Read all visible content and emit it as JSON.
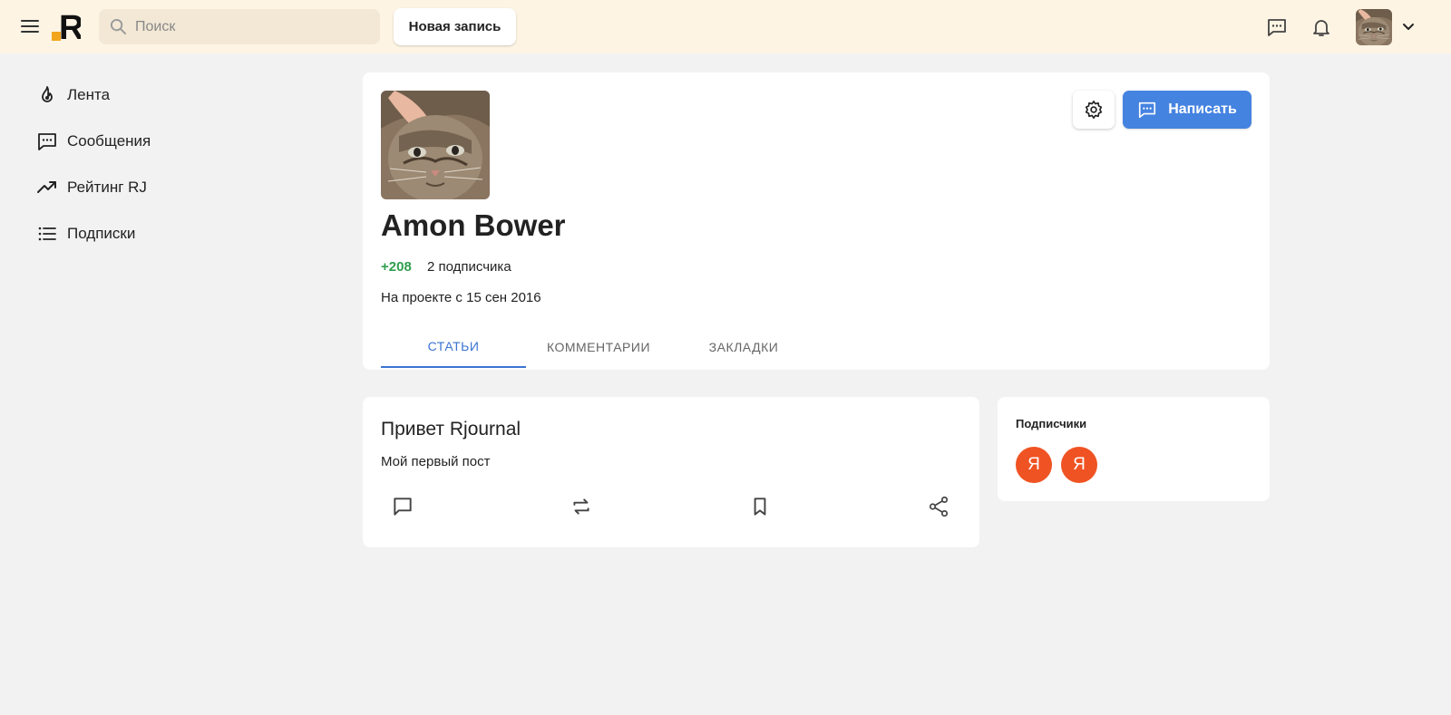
{
  "header": {
    "search_placeholder": "Поиск",
    "new_post_label": "Новая запись",
    "logo_text": "R",
    "bg_color": "#fef4e3",
    "icons": [
      "menu-icon",
      "search-icon",
      "message-icon",
      "bell-icon",
      "chevron-down-icon"
    ]
  },
  "sidebar": {
    "items": [
      {
        "label": "Лента",
        "icon": "fire-icon"
      },
      {
        "label": "Сообщения",
        "icon": "message-icon"
      },
      {
        "label": "Рейтинг RJ",
        "icon": "trending-up-icon"
      },
      {
        "label": "Подписки",
        "icon": "list-icon"
      }
    ]
  },
  "profile": {
    "name": "Amon Bower",
    "rating": "+208",
    "subscribers_text": "2 подписчика",
    "since_text": "На проекте с 15 сен 2016",
    "write_button_label": "Написать",
    "accent_color": "#4583e0",
    "rating_color": "#2f9e4f",
    "tabs": [
      {
        "label": "СТАТЬИ",
        "active": true
      },
      {
        "label": "КОММЕНТАРИИ",
        "active": false
      },
      {
        "label": "ЗАКЛАДКИ",
        "active": false
      }
    ]
  },
  "post": {
    "title": "Привет Rjournal",
    "text": "Мой первый пост",
    "actions": [
      "comment-icon",
      "repost-icon",
      "bookmark-icon",
      "share-icon"
    ]
  },
  "subscribers": {
    "title": "Подписчики",
    "avatar_color": "#f05323",
    "avatars": [
      {
        "letter": "Я"
      },
      {
        "letter": "Я"
      }
    ]
  }
}
